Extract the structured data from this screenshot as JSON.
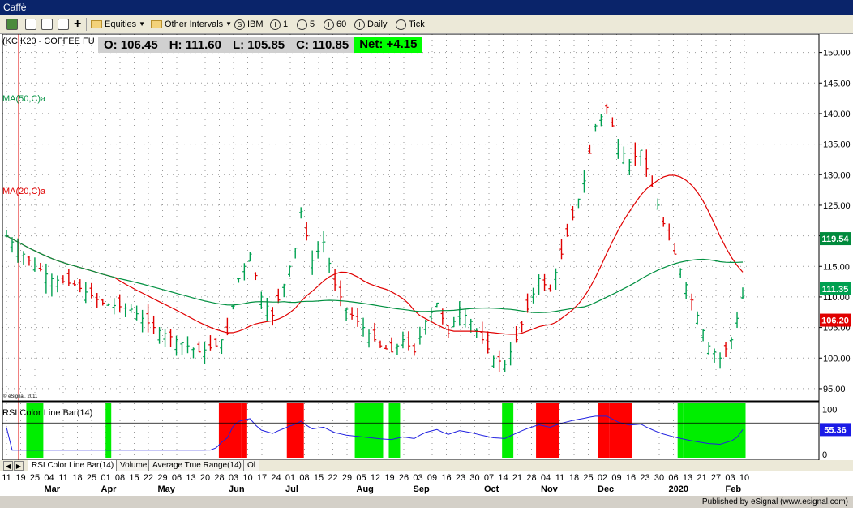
{
  "window": {
    "title": "Caffè"
  },
  "toolbar": {
    "equities": "Equities",
    "other_intervals": "Other Intervals",
    "intervals": [
      {
        "glyph": "S",
        "label": "IBM"
      },
      {
        "glyph": "I",
        "label": "1"
      },
      {
        "glyph": "I",
        "label": "5"
      },
      {
        "glyph": "I",
        "label": "60"
      },
      {
        "glyph": "I",
        "label": "Daily"
      },
      {
        "glyph": "I",
        "label": "Tick"
      }
    ]
  },
  "quote": {
    "symbol": "(KC K20 - COFFEE FU",
    "open": "O: 106.45",
    "high": "H: 111.60",
    "low": "L: 105.85",
    "close": "C: 110.85",
    "net": "Net: +4.15"
  },
  "labels": {
    "ma50": "MA(50,C)a",
    "ma20": "MA(20,C)a",
    "rsi": "RSI Color Line Bar(14)",
    "copyright": "© eSignal, 2011"
  },
  "tabs": [
    "RSI Color Line Bar(14)",
    "Volume",
    "Average True Range(14)",
    "Ol"
  ],
  "footer": {
    "credit": "Published by eSignal (www.esignal.com)"
  },
  "colors": {
    "bull": "#00a050",
    "bear": "#e00000",
    "ma50": "#009040",
    "ma20": "#e00000",
    "rsi_line": "#2020e0",
    "rsi_overbought": "#ff0000",
    "rsi_oversold": "#00ee00",
    "last_price": "#00a050",
    "ma20_value_box": "#e00000",
    "ma50_value_box": "#008a3c",
    "rsi_box": "#1a1ae6"
  },
  "chart_data": {
    "type": "candlestick",
    "symbol": "KC K20 - COFFEE FU",
    "y_ticks": [
      "150.00",
      "145.00",
      "140.00",
      "135.00",
      "130.00",
      "125.00",
      "120.00",
      "115.00",
      "110.00",
      "105.00",
      "100.00",
      "95.00"
    ],
    "ylim": [
      93,
      153
    ],
    "x_day_labels": [
      "11",
      "19",
      "25",
      "04",
      "11",
      "18",
      "25",
      "01",
      "08",
      "15",
      "22",
      "29",
      "06",
      "13",
      "20",
      "28",
      "03",
      "10",
      "17",
      "24",
      "01",
      "08",
      "15",
      "22",
      "29",
      "05",
      "12",
      "19",
      "26",
      "03",
      "09",
      "16",
      "23",
      "30",
      "07",
      "14",
      "21",
      "28",
      "04",
      "11",
      "18",
      "25",
      "02",
      "09",
      "16",
      "23",
      "30",
      "06",
      "13",
      "21",
      "27",
      "03",
      "10"
    ],
    "x_month_labels": [
      {
        "label": "Mar",
        "at_day_index": 3
      },
      {
        "label": "Apr",
        "at_day_index": 7
      },
      {
        "label": "May",
        "at_day_index": 11
      },
      {
        "label": "Jun",
        "at_day_index": 16
      },
      {
        "label": "Jul",
        "at_day_index": 20
      },
      {
        "label": "Aug",
        "at_day_index": 25
      },
      {
        "label": "Sep",
        "at_day_index": 29
      },
      {
        "label": "Oct",
        "at_day_index": 34
      },
      {
        "label": "Nov",
        "at_day_index": 38
      },
      {
        "label": "Dec",
        "at_day_index": 42
      },
      {
        "label": "2020",
        "at_day_index": 47
      },
      {
        "label": "Feb",
        "at_day_index": 51
      }
    ],
    "close_path": [
      [
        0,
        120
      ],
      [
        4,
        116
      ],
      [
        8,
        113
      ],
      [
        12,
        112
      ],
      [
        17,
        109
      ],
      [
        22,
        108
      ],
      [
        26,
        105
      ],
      [
        30,
        103
      ],
      [
        34,
        101
      ],
      [
        37,
        102
      ],
      [
        39,
        104
      ],
      [
        41,
        113
      ],
      [
        43,
        117
      ],
      [
        45,
        110
      ],
      [
        47,
        107
      ],
      [
        49,
        112
      ],
      [
        51,
        118
      ],
      [
        52,
        124
      ],
      [
        54,
        116
      ],
      [
        56,
        119
      ],
      [
        58,
        112
      ],
      [
        60,
        108
      ],
      [
        62,
        106
      ],
      [
        64,
        104
      ],
      [
        66,
        102
      ],
      [
        68,
        101
      ],
      [
        70,
        103
      ],
      [
        72,
        101
      ],
      [
        74,
        106
      ],
      [
        76,
        109
      ],
      [
        78,
        104
      ],
      [
        80,
        108
      ],
      [
        82,
        106
      ],
      [
        84,
        103
      ],
      [
        86,
        100
      ],
      [
        88,
        99
      ],
      [
        90,
        103
      ],
      [
        92,
        108
      ],
      [
        94,
        113
      ],
      [
        96,
        111
      ],
      [
        98,
        117
      ],
      [
        100,
        123
      ],
      [
        102,
        129
      ],
      [
        104,
        138
      ],
      [
        106,
        141
      ],
      [
        108,
        135
      ],
      [
        110,
        132
      ],
      [
        112,
        134
      ],
      [
        114,
        128
      ],
      [
        116,
        122
      ],
      [
        118,
        117
      ],
      [
        120,
        112
      ],
      [
        122,
        107
      ],
      [
        124,
        102
      ],
      [
        126,
        100
      ],
      [
        128,
        103
      ],
      [
        130,
        110
      ]
    ],
    "visible_bars": 131,
    "ma50": {
      "name": "MA(50,C)a",
      "last_value": 119.54
    },
    "ma20": {
      "name": "MA(20,C)a",
      "last_value": 106.2
    },
    "last_price": 111.35,
    "rsi": {
      "name": "RSI Color Line Bar(14)",
      "y_ticks": [
        "100",
        "50",
        "0"
      ],
      "ylim": [
        -5,
        110
      ],
      "upper_band": 70,
      "lower_band": 30,
      "last_value": 55.36,
      "overbought_ranges": [
        [
          38,
          41
        ],
        [
          42,
          42
        ],
        [
          50,
          52
        ],
        [
          94,
          97
        ],
        [
          105,
          106
        ],
        [
          107,
          110
        ]
      ],
      "oversold_ranges": [
        [
          4,
          6
        ],
        [
          18,
          18
        ],
        [
          62,
          66
        ],
        [
          68,
          69
        ],
        [
          88,
          89
        ],
        [
          119,
          119
        ],
        [
          120,
          130
        ]
      ]
    }
  }
}
